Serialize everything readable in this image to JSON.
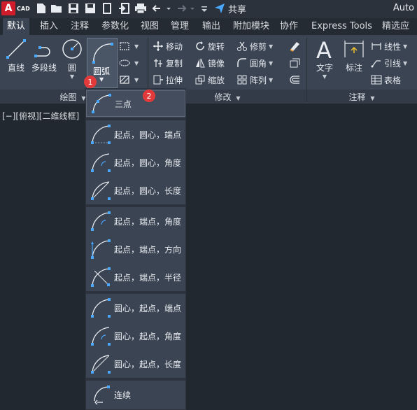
{
  "app": {
    "logo_letter": "A",
    "logo_sub": "CAD",
    "title": "Auto",
    "share_label": "共享"
  },
  "tabs": [
    "默认",
    "插入",
    "注释",
    "参数化",
    "视图",
    "管理",
    "输出",
    "附加模块",
    "协作",
    "Express Tools",
    "精选应用"
  ],
  "draw_panel": {
    "title": "绘图",
    "line": "直线",
    "polyline": "多段线",
    "circle": "圆",
    "arc": "圆弧"
  },
  "modify_panel": {
    "title": "修改",
    "move": "移动",
    "rotate": "旋转",
    "trim": "修剪",
    "copy": "复制",
    "mirror": "镜像",
    "fillet": "圆角",
    "stretch": "拉伸",
    "scale": "缩放",
    "array": "阵列"
  },
  "annotation_panel": {
    "title": "注释",
    "text": "文字",
    "dimension": "标注",
    "linear": "线性",
    "leader": "引线",
    "table": "表格"
  },
  "viewport_label": "[−][俯视][二维线框]",
  "arc_menu": {
    "groups": [
      [
        "三点"
      ],
      [
        "起点，圆心，端点",
        "起点，圆心，角度",
        "起点，圆心，长度"
      ],
      [
        "起点，端点，角度",
        "起点，端点，方向",
        "起点，端点，半径"
      ],
      [
        "圆心，起点，端点",
        "圆心，起点，角度",
        "圆心，起点，长度"
      ],
      [
        "连续"
      ]
    ]
  },
  "badges": {
    "one": "1",
    "two": "2"
  },
  "colors": {
    "accent_red": "#e23a3a",
    "ribbon_bg": "#3b4453",
    "canvas_bg": "#212830"
  }
}
